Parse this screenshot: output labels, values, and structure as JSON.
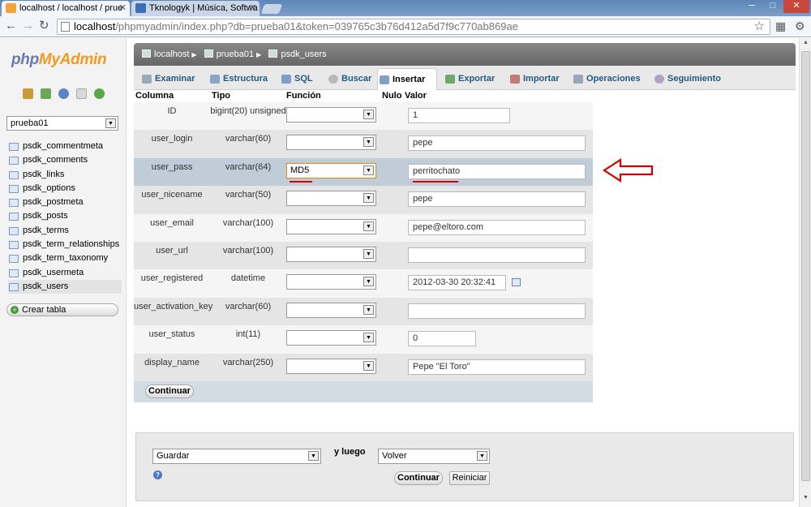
{
  "browser": {
    "tabs": [
      {
        "title": "localhost / localhost / prue"
      },
      {
        "title": "Tknologyk | Música, Softwa"
      }
    ],
    "url_host": "localhost",
    "url_path": "/phpmyadmin/index.php?db=prueba01&token=039765c3b76d412a5d7f9c770ab869ae"
  },
  "sidebar": {
    "logo_php": "php",
    "logo_myadmin": "MyAdmin",
    "db_selected": "prueba01",
    "tables": [
      "psdk_commentmeta",
      "psdk_comments",
      "psdk_links",
      "psdk_options",
      "psdk_postmeta",
      "psdk_posts",
      "psdk_terms",
      "psdk_term_relationships",
      "psdk_term_taxonomy",
      "psdk_usermeta",
      "psdk_users"
    ],
    "create_table": "Crear tabla"
  },
  "breadcrumb": {
    "server": "localhost",
    "database": "prueba01",
    "table": "psdk_users"
  },
  "tabs": [
    "Examinar",
    "Estructura",
    "SQL",
    "Buscar",
    "Insertar",
    "Exportar",
    "Importar",
    "Operaciones",
    "Seguimiento"
  ],
  "table": {
    "headers": {
      "column": "Columna",
      "type": "Tipo",
      "function": "Función",
      "null": "Nulo",
      "value": "Valor"
    },
    "rows": [
      {
        "column": "ID",
        "type": "bigint(20) unsigned",
        "function": "",
        "value": "1"
      },
      {
        "column": "user_login",
        "type": "varchar(60)",
        "function": "",
        "value": "pepe"
      },
      {
        "column": "user_pass",
        "type": "varchar(64)",
        "function": "MD5",
        "value": "perritochato"
      },
      {
        "column": "user_nicename",
        "type": "varchar(50)",
        "function": "",
        "value": "pepe"
      },
      {
        "column": "user_email",
        "type": "varchar(100)",
        "function": "",
        "value": "pepe@eltoro.com"
      },
      {
        "column": "user_url",
        "type": "varchar(100)",
        "function": "",
        "value": ""
      },
      {
        "column": "user_registered",
        "type": "datetime",
        "function": "",
        "value": "2012-03-30 20:32:41"
      },
      {
        "column": "user_activation_key",
        "type": "varchar(60)",
        "function": "",
        "value": ""
      },
      {
        "column": "user_status",
        "type": "int(11)",
        "function": "",
        "value": "0"
      },
      {
        "column": "display_name",
        "type": "varchar(250)",
        "function": "",
        "value": "Pepe \"El Toro\""
      }
    ],
    "continue_label": "Continuar"
  },
  "bottom": {
    "action_select": "Guardar",
    "and_then": "y luego",
    "then_select": "Volver",
    "continue_label": "Continuar",
    "reset_label": "Reiniciar"
  },
  "colors": {
    "annotation_red": "#d00000",
    "pma_blue": "#6c78af",
    "pma_orange": "#f29a1f"
  }
}
